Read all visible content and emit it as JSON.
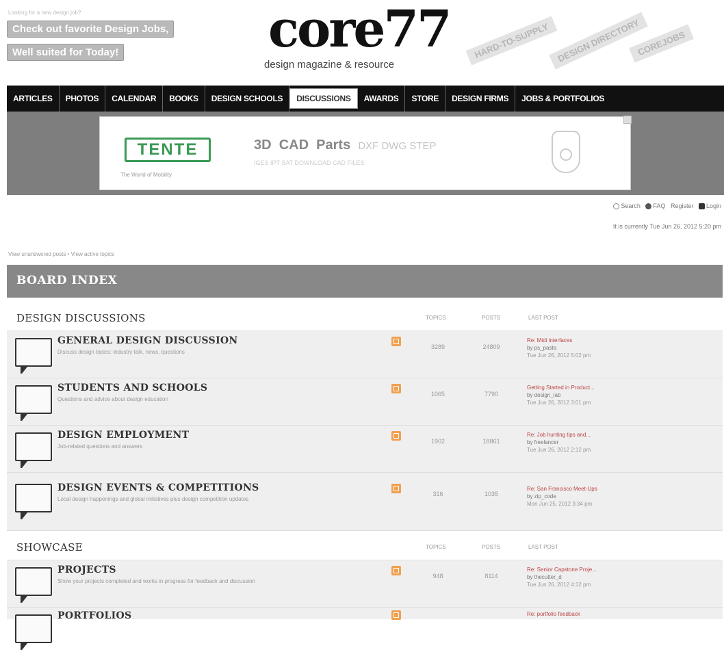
{
  "header": {
    "promo_small": "Looking for a new design job?",
    "promo_line1": "Check out favorite Design Jobs,",
    "promo_line2": "Well suited for Today!",
    "logo": "core77",
    "tagline": "design magazine & resource",
    "signs": [
      "HARD-TO-SUPPLY",
      "DESIGN DIRECTORY",
      "COREJOBS"
    ]
  },
  "nav": {
    "items": [
      "ARTICLES",
      "PHOTOS",
      "CALENDAR",
      "BOOKS",
      "DESIGN SCHOOLS",
      "DISCUSSIONS",
      "AWARDS",
      "STORE",
      "DESIGN FIRMS",
      "JOBS & PORTFOLIOS"
    ],
    "active_index": 5
  },
  "banner": {
    "brand": "TENTE",
    "brand_tag": "The World of Mobility",
    "main_3d": "3D",
    "main_cad": "CAD",
    "main_parts": "Parts",
    "formats": "DXF  DWG  STEP",
    "sub": "IGES   IPT   SAT   DOWNLOAD CAD FILES"
  },
  "user_links": {
    "search": "Search",
    "faq": "FAQ",
    "register": "Register",
    "login": "Login",
    "note": "It is currently Tue Jun 26, 2012 5:20 pm"
  },
  "crumbs": "View unanswered posts • View active topics",
  "board": {
    "title": "BOARD INDEX",
    "categories": [
      {
        "name": "DESIGN DISCUSSIONS",
        "col_topics": "TOPICS",
        "col_posts": "POSTS",
        "col_last": "LAST POST",
        "forums": [
          {
            "name": "GENERAL DESIGN DISCUSSION",
            "desc": "Discuss design topics: industry talk, news, questions",
            "topics": "3289",
            "posts": "24809",
            "last1": "Re: Midi interfaces",
            "last2": "by ps_pasta",
            "last3": "Tue Jun 26, 2012 5:02 pm"
          },
          {
            "name": "STUDENTS AND SCHOOLS",
            "desc": "Questions and advice about design education",
            "topics": "1065",
            "posts": "7790",
            "last1": "Getting Started in Product...",
            "last2": "by design_lab",
            "last3": "Tue Jun 26, 2012 3:01 pm"
          },
          {
            "name": "DESIGN EMPLOYMENT",
            "desc": "Job-related questions and answers",
            "topics": "1902",
            "posts": "18861",
            "last1": "Re: Job hunting tips and...",
            "last2": "by freelancer",
            "last3": "Tue Jun 26, 2012 2:12 pm"
          },
          {
            "name": "DESIGN EVENTS & COMPETITIONS",
            "desc": "Local design happenings and global initiatives plus design competition updates",
            "topics": "316",
            "posts": "1035",
            "last1": "Re: San Francisco Meet-Ups",
            "last2": "by zip_code",
            "last3": "Mon Jun 25, 2012 3:34 pm"
          }
        ]
      },
      {
        "name": "SHOWCASE",
        "col_topics": "TOPICS",
        "col_posts": "POSTS",
        "col_last": "LAST POST",
        "forums": [
          {
            "name": "PROJECTS",
            "desc": "Show your projects completed and works in progress for feedback and discussion",
            "topics": "948",
            "posts": "8114",
            "last1": "Re: Senior Capstone Proje...",
            "last2": "by thecutter_d",
            "last3": "Tue Jun 26, 2012 4:12 pm"
          },
          {
            "name": "PORTFOLIOS",
            "desc": "",
            "topics": "",
            "posts": "",
            "last1": "Re: portfolio feedback",
            "last2": "",
            "last3": ""
          }
        ]
      }
    ]
  },
  "colors": {
    "nav_bg": "#111111",
    "board_header_bg": "#888888",
    "forum_row_bg": "#efefef",
    "last_post_link": "#bb4444",
    "rss": "#f0a050",
    "tente_green": "#3a9a55"
  }
}
